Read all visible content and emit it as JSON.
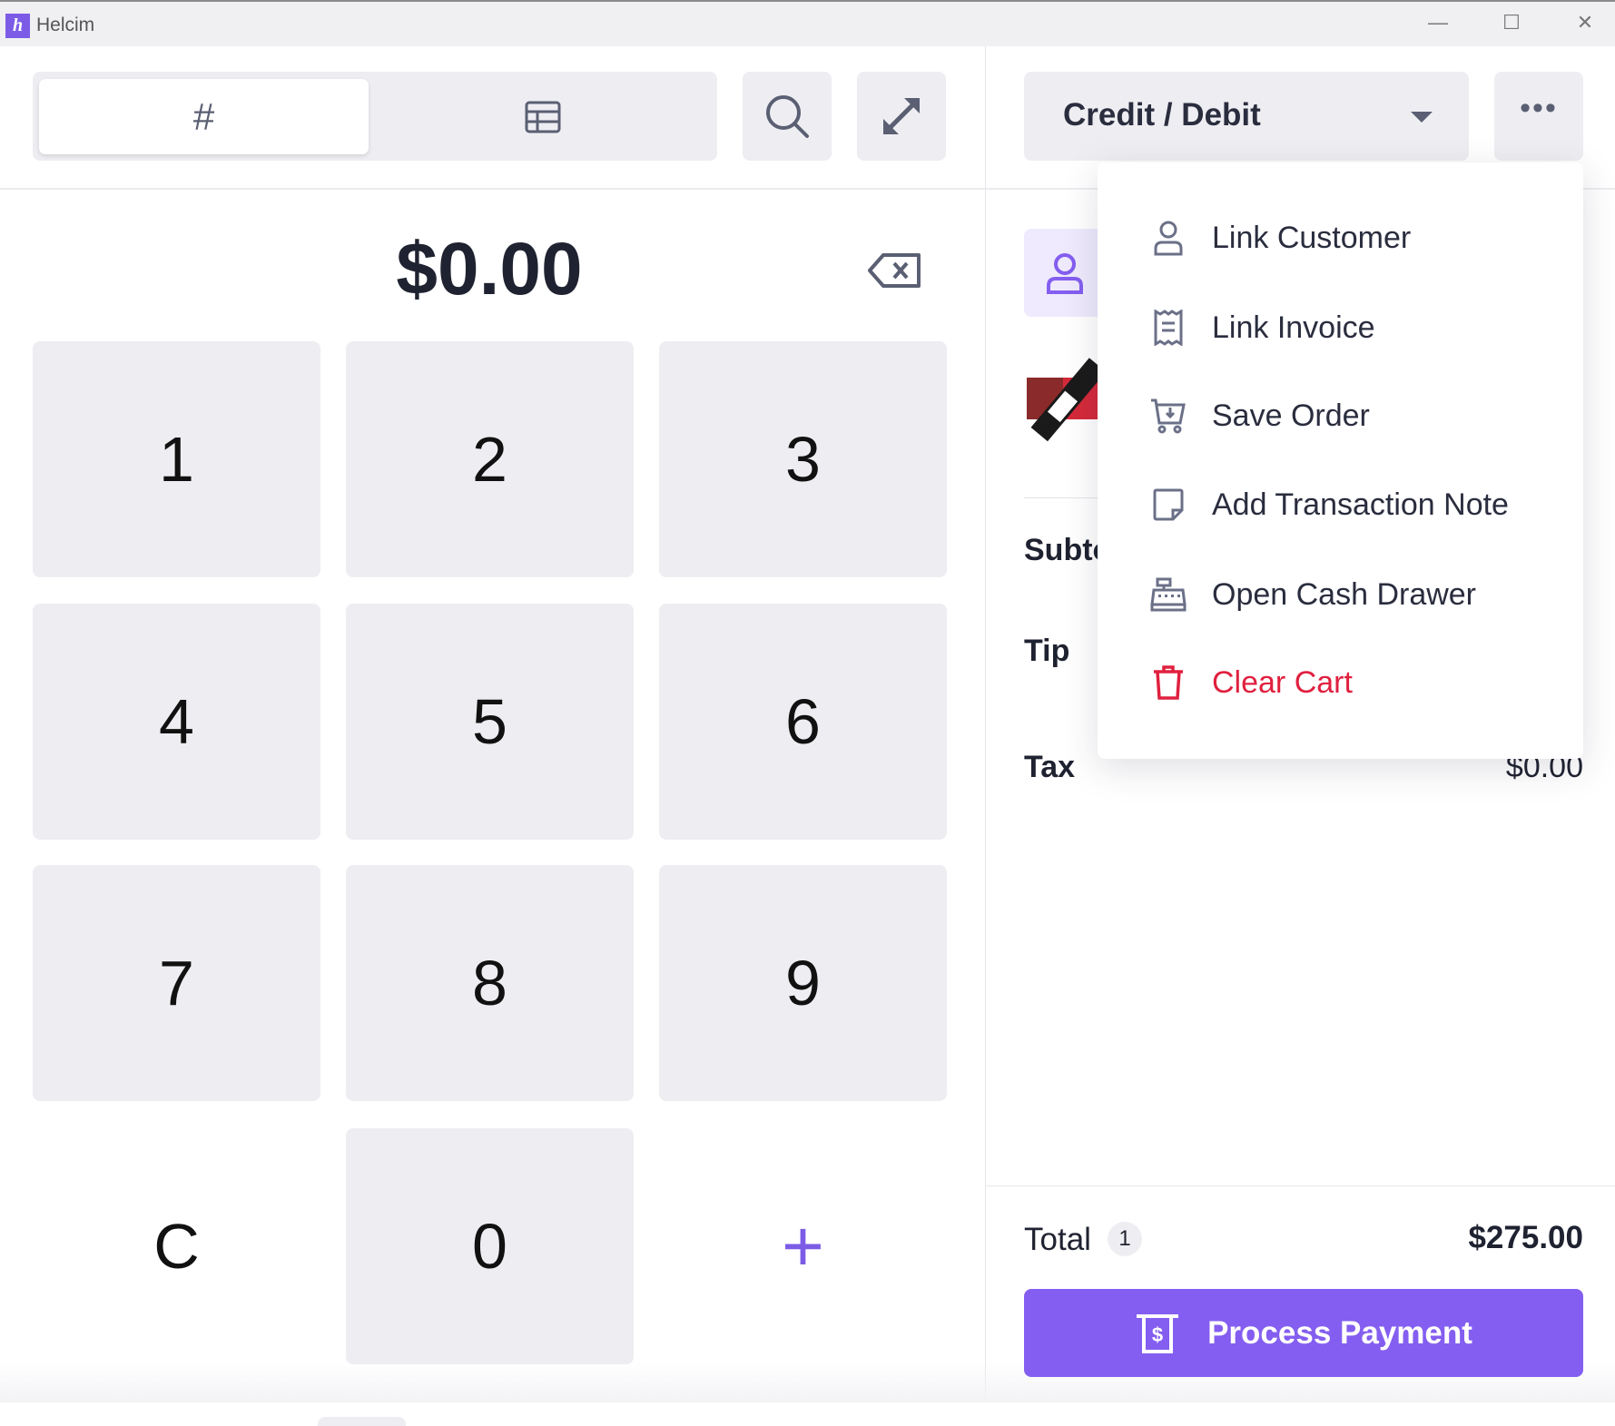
{
  "window": {
    "title": "Helcim",
    "logo_letter": "h",
    "minimize": "—",
    "maximize": "☐",
    "close": "✕"
  },
  "keypad_panel": {
    "tabs": [
      {
        "label": "#",
        "name": "keypad"
      },
      {
        "label": "",
        "name": "grid",
        "icon": "table-icon"
      }
    ],
    "search_icon": "search-icon",
    "expand_icon": "expand-icon",
    "amount": "$0.00",
    "keys": [
      "1",
      "2",
      "3",
      "4",
      "5",
      "6",
      "7",
      "8",
      "9",
      "C",
      "0",
      "+"
    ]
  },
  "cart_panel": {
    "payment_method": "Credit / Debit",
    "more_label": "•••",
    "summary": {
      "subtotal_label": "Subtotal",
      "tip_label": "Tip",
      "tax_label": "Tax",
      "tax_value": "$0.00"
    },
    "total_label": "Total",
    "item_count": "1",
    "total_value": "$275.00",
    "process_payment": "Process Payment"
  },
  "menu": {
    "items": [
      {
        "label": "Link Customer",
        "icon": "user-icon"
      },
      {
        "label": "Link Invoice",
        "icon": "receipt-icon"
      },
      {
        "label": "Save Order",
        "icon": "cart-icon"
      },
      {
        "label": "Add Transaction Note",
        "icon": "note-icon"
      },
      {
        "label": "Open Cash Drawer",
        "icon": "cash-register-icon"
      },
      {
        "label": "Clear Cart",
        "icon": "trash-icon",
        "danger": true
      }
    ]
  },
  "colors": {
    "accent": "#845ef0",
    "danger": "#e0203f",
    "button_bg": "#eeeef2"
  }
}
